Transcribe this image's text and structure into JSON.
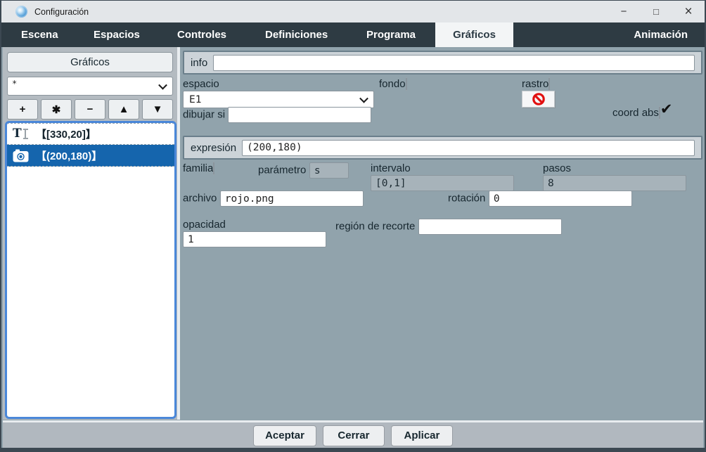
{
  "window": {
    "title": "Configuración",
    "controls": {
      "minimize": "−",
      "maximize": "□",
      "close": "×"
    }
  },
  "tabs": [
    {
      "label": "Escena",
      "active": false
    },
    {
      "label": "Espacios",
      "active": false
    },
    {
      "label": "Controles",
      "active": false
    },
    {
      "label": "Definiciones",
      "active": false
    },
    {
      "label": "Programa",
      "active": false
    },
    {
      "label": "Gráficos",
      "active": true
    },
    {
      "label": "Animación",
      "active": false
    }
  ],
  "sidebar": {
    "header": "Gráficos",
    "filter_value": "*",
    "toolbar": [
      {
        "name": "add",
        "glyph": "+"
      },
      {
        "name": "asterisk",
        "glyph": "✱"
      },
      {
        "name": "remove",
        "glyph": "−"
      },
      {
        "name": "move-up",
        "glyph": "▲"
      },
      {
        "name": "move-down",
        "glyph": "▼"
      }
    ],
    "items": [
      {
        "icon": "text",
        "label": "【[330,20]】",
        "selected": false
      },
      {
        "icon": "image",
        "label": "【(200,180)】",
        "selected": true
      }
    ]
  },
  "form": {
    "info": {
      "label": "info",
      "value": ""
    },
    "espacio": {
      "label": "espacio",
      "value": "E1"
    },
    "fondo": {
      "label": "fondo",
      "checked": false
    },
    "rastro": {
      "label": "rastro",
      "checked": false
    },
    "dibujar_si": {
      "label": "dibujar si",
      "value": ""
    },
    "coord_abs": {
      "label": "coord abs",
      "checked": true,
      "check_glyph": "✔"
    },
    "expresion": {
      "label": "expresión",
      "value": "(200,180)"
    },
    "familia": {
      "label": "familia",
      "checked": false
    },
    "parametro": {
      "label": "parámetro",
      "value": "s",
      "disabled": true
    },
    "intervalo": {
      "label": "intervalo",
      "value": "[0,1]",
      "disabled": true
    },
    "pasos": {
      "label": "pasos",
      "value": "8",
      "disabled": true
    },
    "archivo": {
      "label": "archivo",
      "value": "rojo.png"
    },
    "rotacion": {
      "label": "rotación",
      "value": "0"
    },
    "opacidad": {
      "label": "opacidad",
      "value": "1"
    },
    "region_recorte": {
      "label": "región de recorte",
      "value": ""
    }
  },
  "footer": {
    "buttons": [
      {
        "label": "Aceptar"
      },
      {
        "label": "Cerrar"
      },
      {
        "label": "Aplicar"
      }
    ]
  },
  "colors": {
    "accent_blue": "#1565ad",
    "list_border_blue": "#4a87d9",
    "tabbar_dark": "#2e3b43",
    "panel_gray_blue": "#91a3ac",
    "row_bg": "#ccd3d8",
    "no_entry_red": "#e11010"
  }
}
